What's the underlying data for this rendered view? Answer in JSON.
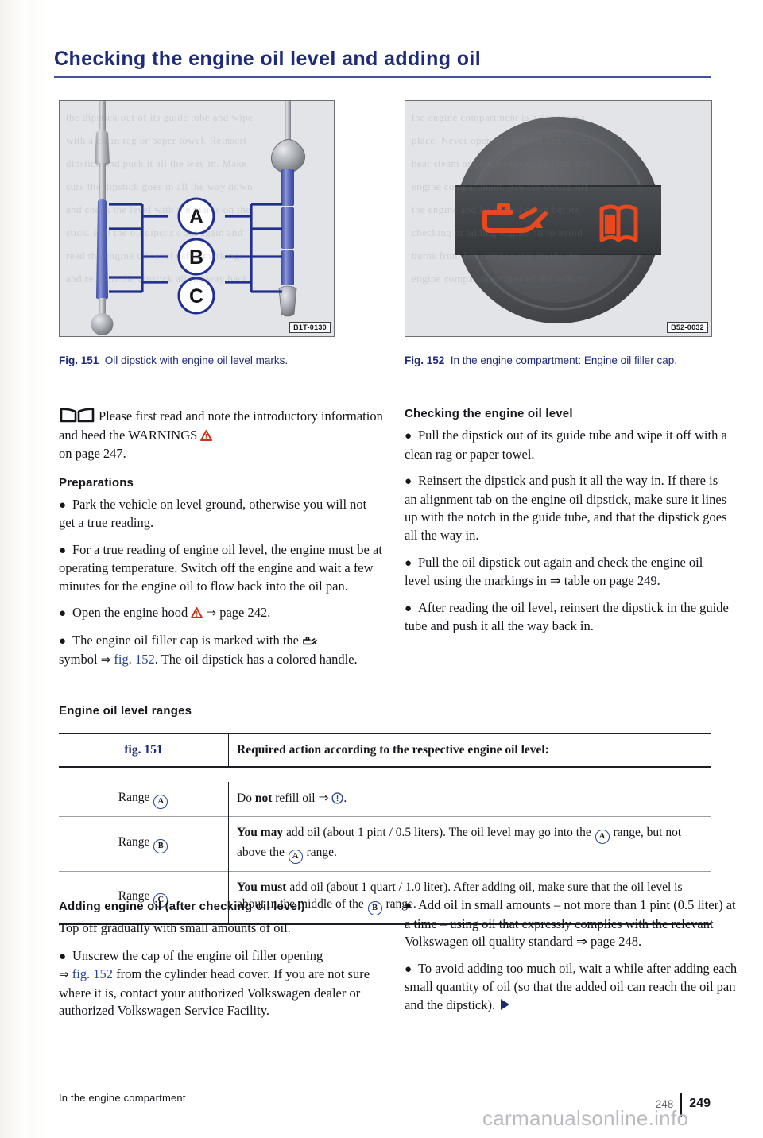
{
  "document": {
    "title": "Checking the engine oil level and adding oil",
    "watermark": "carmanualsonline.info"
  },
  "figures": [
    {
      "id": "fig-151",
      "code": "B1T-0130",
      "caption_label": "Fig. 151",
      "caption_text": "Oil dipstick with engine oil level marks.",
      "markers": [
        "A",
        "B",
        "C"
      ]
    },
    {
      "id": "fig-152",
      "code": "B52-0032",
      "caption_label": "Fig. 152",
      "caption_text": "In the engine compartment: Engine oil filler cap.",
      "symbols": [
        "oil-can-icon",
        "book-icon"
      ]
    }
  ],
  "left_column": {
    "intro_note": "Please first read and note the introductory information and heed the WARNINGS",
    "intro_note_cont": "on page 247.",
    "preparations_heading": "Preparations",
    "bullets": [
      "Park the vehicle on level ground, otherwise you will not get a true reading.",
      "For a true reading of engine oil level, the engine must be at operating temperature. Switch off the engine and wait a few minutes for the engine oil to flow back into the oil pan.",
      "Open the engine hood",
      "The engine oil filler cap is marked with the"
    ],
    "hood_page_ref": "page 242.",
    "cap_symbol_ref_pre": "symbol",
    "cap_symbol_ref_link": "fig. 152",
    "cap_symbol_ref_post": ". The oil dipstick has a colored handle."
  },
  "right_column": {
    "heading": "Checking the engine oil level",
    "bullets": [
      "Pull the dipstick out of its guide tube and wipe it off with a clean rag or paper towel.",
      "Reinsert the dipstick and push it all the way in. If there is an alignment tab on the engine oil dipstick, make sure it lines up with the notch in the guide tube, and that the dipstick goes all the way in.",
      "Pull the oil dipstick out again and check the engine oil level using the markings in ⇒ table on page 249.",
      "After reading the oil level, reinsert the dipstick in the guide tube and push it all the way back in."
    ]
  },
  "table_section": {
    "heading": "Engine oil level ranges",
    "header": {
      "col1": "fig. 151",
      "col2": "Required action according to the respective engine oil level:"
    },
    "rows": [
      {
        "range_label": "Range",
        "range_mark": "A",
        "action_pre": "Do ",
        "action_bold": "not",
        "action_post": " refill oil ⇒ ",
        "action_end": "."
      },
      {
        "range_label": "Range",
        "range_mark": "B",
        "bold_lead": "You may",
        "text_1": " add oil (about 1 pint / 0.5 liters). The oil level may go into the ",
        "mark_1": "A",
        "text_2": " range, but not above the ",
        "mark_2": "A",
        "text_3": " range."
      },
      {
        "range_label": "Range",
        "range_mark": "C",
        "bold_lead": "You must",
        "text_1": " add oil (about 1 quart / 1.0 liter). After adding oil, make sure that the oil level is about in the middle of the ",
        "mark_1": "B",
        "text_2": " range."
      }
    ]
  },
  "bottom_left": {
    "heading": "Adding engine oil (after checking oil level)",
    "intro": "Top off gradually with small amounts of oil.",
    "bullet_pre": "Unscrew the cap of the engine oil filler opening ",
    "bullet_link": "fig. 152",
    "bullet_post": " from the cylinder head cover. If you are not sure where it is, contact your authorized Volkswagen dealer or authorized Volkswagen Service Facility."
  },
  "bottom_right": {
    "bullets": [
      "Add oil in small amounts – not more than 1 pint (0.5 liter) at a time – using oil that expressly complies with the relevant Volkswagen oil quality standard ⇒ page 248.",
      "To avoid adding too much oil, wait a while after adding each small quantity of oil (so that the added oil can reach the oil pan and the dipstick)."
    ],
    "continue_marker": "continue-arrow-icon"
  },
  "footer": {
    "section_label": "In the engine compartment",
    "prev_page": "248",
    "current_page": "249"
  },
  "colors": {
    "heading_blue": "#1e2a7a",
    "link_blue": "#27429a",
    "warning_red": "#d32f18",
    "oil_orange": "#e8481c",
    "dipstick_blue": "#5566bb"
  }
}
